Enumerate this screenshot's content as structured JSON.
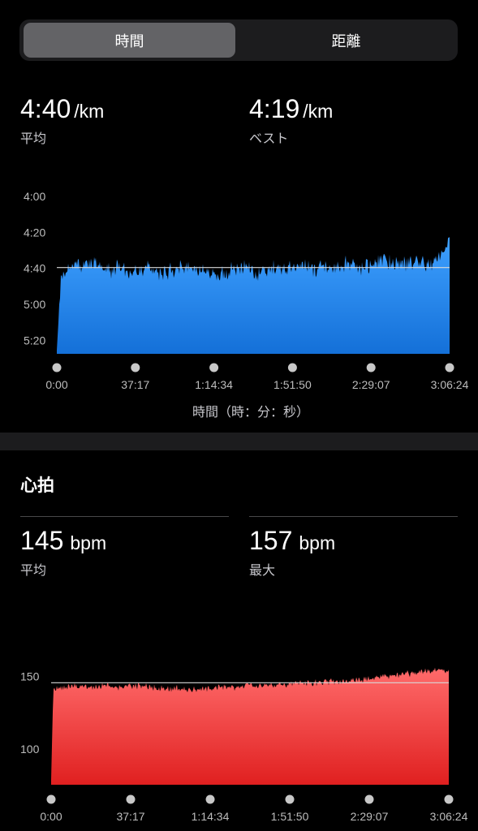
{
  "tabs": [
    {
      "label": "時間",
      "active": true
    },
    {
      "label": "距離",
      "active": false
    }
  ],
  "pace": {
    "avg_value": "4:40",
    "avg_unit": "/km",
    "avg_label": "平均",
    "best_value": "4:19",
    "best_unit": "/km",
    "best_label": "ベスト",
    "x_axis_title": "時間（時：分：秒）"
  },
  "heart": {
    "section_title": "心拍",
    "avg_value": "145",
    "avg_unit": "bpm",
    "avg_label": "平均",
    "max_value": "157",
    "max_unit": "bpm",
    "max_label": "最大"
  },
  "colors": {
    "pace_fill_top": "#3ea0ff",
    "pace_fill_bottom": "#1470d8",
    "hr_fill_top": "#ff6b6b",
    "hr_fill_bottom": "#e02020",
    "avg_line": "#d8d8d8",
    "tick_dot": "#c8c8c8"
  },
  "chart_data": [
    {
      "type": "area",
      "title": "",
      "xlabel": "時間（時：分：秒）",
      "ylabel": "",
      "y_inverted": true,
      "x_tick_labels": [
        "0:00",
        "37:17",
        "1:14:34",
        "1:51:50",
        "2:29:07",
        "3:06:24"
      ],
      "y_tick_labels": [
        "4:00",
        "4:20",
        "4:40",
        "5:00",
        "5:20"
      ],
      "y_ticks_sec": [
        240,
        260,
        280,
        300,
        320
      ],
      "ylim_sec": [
        235,
        328
      ],
      "average_sec": 280,
      "x_min": 0,
      "x_max": 11184,
      "series": [
        {
          "x": [
            0,
            120,
            300,
            600,
            900,
            1200,
            1500,
            1800,
            2100,
            2400,
            2700,
            3000,
            3300,
            3600,
            3900,
            4200,
            4500,
            4800,
            5100,
            5400,
            5700,
            6000,
            6300,
            6600,
            6900,
            7200,
            7500,
            7800,
            8100,
            8400,
            8700,
            9000,
            9300,
            9600,
            9900,
            10200,
            10500,
            10800,
            11184
          ],
          "y": [
            326,
            285,
            281,
            279,
            278,
            280,
            282,
            279,
            283,
            281,
            280,
            284,
            282,
            280,
            283,
            281,
            285,
            282,
            281,
            280,
            283,
            281,
            280,
            281,
            279,
            280,
            281,
            280,
            278,
            279,
            280,
            279,
            277,
            279,
            278,
            277,
            279,
            276,
            266
          ]
        }
      ]
    },
    {
      "type": "area",
      "title": "心拍",
      "xlabel": "",
      "ylabel": "",
      "x_tick_labels": [
        "0:00",
        "37:17",
        "1:14:34",
        "1:51:50",
        "2:29:07",
        "3:06:24"
      ],
      "y_tick_labels": [
        "150",
        "100"
      ],
      "y_ticks": [
        150,
        100
      ],
      "ylim": [
        75,
        168
      ],
      "average": 145,
      "x_min": 0,
      "x_max": 11184,
      "series": [
        {
          "x": [
            0,
            60,
            150,
            400,
            800,
            1200,
            1600,
            2000,
            2400,
            2800,
            3200,
            3600,
            4000,
            4400,
            4800,
            5200,
            5600,
            6000,
            6400,
            6800,
            7200,
            7600,
            8000,
            8400,
            8800,
            9200,
            9600,
            10000,
            10400,
            10800,
            11184
          ],
          "y": [
            78,
            140,
            141,
            142,
            143,
            142,
            143,
            142,
            143,
            142,
            141,
            141,
            140,
            141,
            142,
            142,
            143,
            143,
            144,
            144,
            145,
            145,
            146,
            146,
            147,
            149,
            150,
            151,
            152,
            153,
            154
          ]
        }
      ]
    }
  ]
}
